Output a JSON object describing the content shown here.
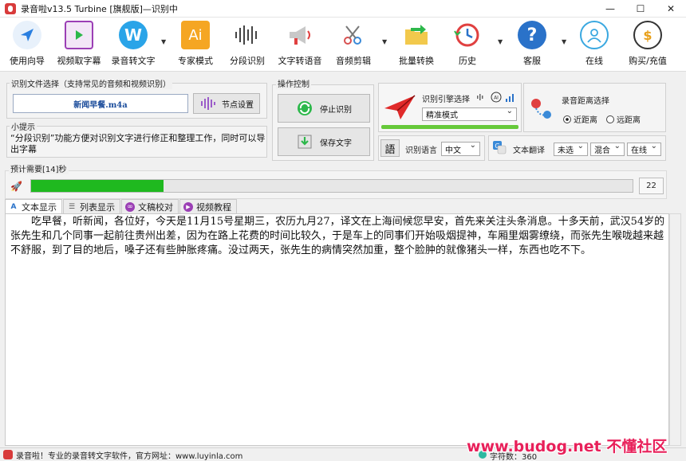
{
  "window": {
    "title": "录音啦v13.5 Turbine [旗舰版]—识别中",
    "controls": [
      "—",
      "☐",
      "✕"
    ]
  },
  "toolbar": [
    {
      "label": "使用向导",
      "icon": "navigation-arrow-icon",
      "color": "#2a7fe0"
    },
    {
      "label": "视频取字幕",
      "icon": "video-subtitle-icon",
      "color": "#9b3fb5"
    },
    {
      "label": "录音转文字",
      "icon": "word-icon",
      "color": "#2aa4e8"
    },
    {
      "label": "专家模式",
      "icon": "ai-expert-icon",
      "color": "#f5a623"
    },
    {
      "label": "分段识别",
      "icon": "waveform-icon",
      "color": "#444444"
    },
    {
      "label": "文字转语音",
      "icon": "megaphone-icon",
      "color": "#c8c8c8"
    },
    {
      "label": "音频剪辑",
      "icon": "scissors-icon",
      "color": "#d85050"
    },
    {
      "label": "批量转换",
      "icon": "folder-convert-icon",
      "color": "#f2c94c"
    },
    {
      "label": "历史",
      "icon": "history-clock-icon",
      "color": "#e04040"
    },
    {
      "label": "客服",
      "icon": "help-icon",
      "color": "#2a72c9"
    },
    {
      "label": "在线",
      "icon": "user-online-icon",
      "color": "#3aa8e0"
    },
    {
      "label": "购买/充值",
      "icon": "purchase-icon",
      "color": "#333333"
    }
  ],
  "file_select": {
    "title": "识别文件选择（支持常见的音频和视频识别）",
    "filename": "新闻早餐.m4a",
    "node_button": "节点设置"
  },
  "tips": {
    "title": "小提示",
    "text": "“分段识别”功能方便对识别文字进行修正和整理工作，同时可以导出字幕"
  },
  "operation": {
    "title": "操作控制",
    "stop_button": "停止识别",
    "save_button": "保存文字"
  },
  "engine": {
    "label": "识别引擎选择",
    "value": "精准模式"
  },
  "distance": {
    "label": "录音距离选择",
    "options": [
      "近距离",
      "远距离"
    ],
    "selected": "近距离"
  },
  "language": {
    "label": "识别语言",
    "value": "中文",
    "icon_text": "語"
  },
  "translate": {
    "label": "文本翻译",
    "options": [
      "未选",
      "混合",
      "在线"
    ]
  },
  "progress": {
    "label": "预计需要[14]秒",
    "fraction": 0.22,
    "count": "22"
  },
  "tabs": [
    {
      "label": "文本显示",
      "icon": "text-display-icon",
      "active": true
    },
    {
      "label": "列表显示",
      "icon": "list-display-icon",
      "active": false
    },
    {
      "label": "文稿校对",
      "icon": "proofread-icon",
      "active": false
    },
    {
      "label": "视频教程",
      "icon": "video-tutorial-icon",
      "active": false
    }
  ],
  "editor": {
    "text": "吃早餐，听新闻，各位好，今天是11月15号星期三，农历九月27，译文在上海间候您早安，首先来关注头条消息。十多天前，武汉54岁的张先生和几个同事一起前往贵州出差，因为在路上花费的时间比较久，于是车上的同事们开始吸烟提神，车厢里烟雾缭绕，而张先生喉咙越来越不舒服，到了目的地后，嗓子还有些肿胀疼痛。没过两天，张先生的病情突然加重，整个脸肿的就像猪头一样，东西也吃不下。"
  },
  "status": {
    "text": "录音啦！专业的录音转文字软件，官方网址：www.luyinla.com",
    "char_count": "字符数：360"
  },
  "watermark": "www.budog.net 不懂社区"
}
